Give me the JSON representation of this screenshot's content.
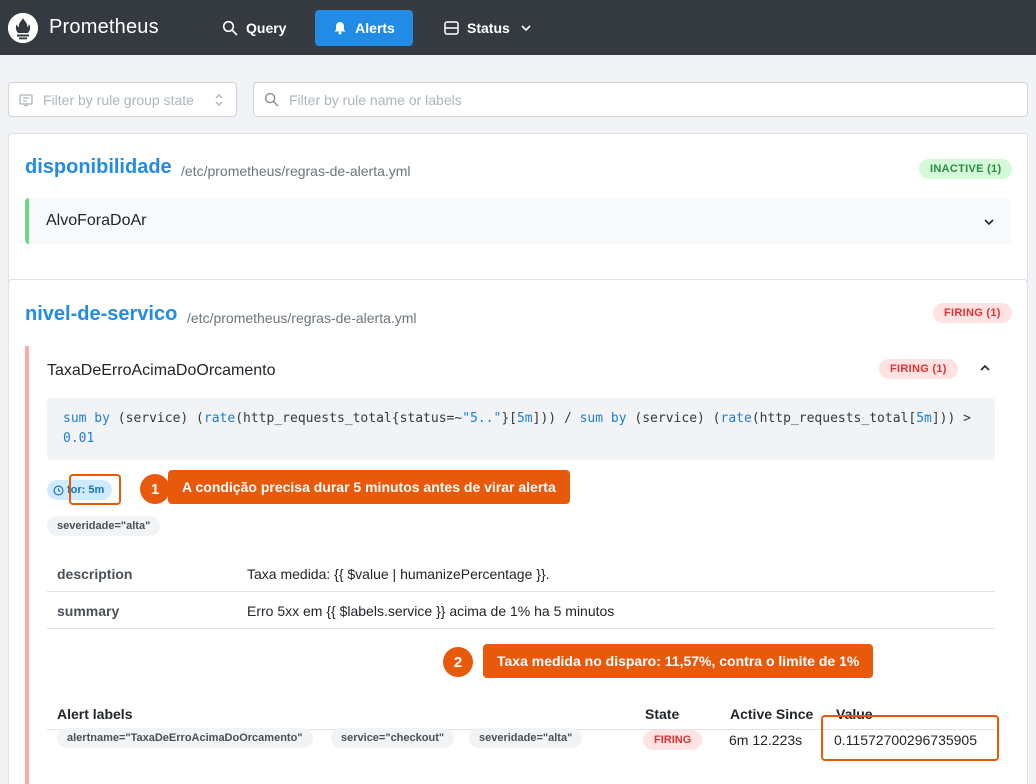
{
  "app": {
    "name": "Prometheus",
    "nav": {
      "query": "Query",
      "alerts": "Alerts",
      "status": "Status"
    }
  },
  "filters": {
    "group_state_placeholder": "Filter by rule group state",
    "search_placeholder": "Filter by rule name or labels"
  },
  "groups": [
    {
      "name": "disponibilidade",
      "file": "/etc/prometheus/regras-de-alerta.yml",
      "badge": "INACTIVE (1)",
      "rules": [
        {
          "name": "AlvoForaDoAr"
        }
      ]
    },
    {
      "name": "nivel-de-servico",
      "file": "/etc/prometheus/regras-de-alerta.yml",
      "badge": "FIRING (1)",
      "rule": {
        "name": "TaxaDeErroAcimaDoOrcamento",
        "badge": "FIRING (1)",
        "expr_line1": "sum by (service) (rate(http_requests_total{status=~\"5..\"}[5m])) / sum by (service) (rate(http_requests_total[5m])) >",
        "expr_line2": "0.01",
        "for": "for: 5m",
        "labels": [
          "severidade=\"alta\""
        ],
        "annotations": [
          {
            "key": "description",
            "value": "Taxa medida: {{ $value | humanizePercentage }}."
          },
          {
            "key": "summary",
            "value": "Erro 5xx em {{ $labels.service }} acima de 1% ha 5 minutos"
          }
        ],
        "alerts_table": {
          "headers": {
            "labels": "Alert labels",
            "state": "State",
            "active_since": "Active Since",
            "value": "Value"
          },
          "rows": [
            {
              "labels": [
                "alertname=\"TaxaDeErroAcimaDoOrcamento\"",
                "service=\"checkout\"",
                "severidade=\"alta\""
              ],
              "state": "FIRING",
              "active_since": "6m 12.223s",
              "value": "0.11572700296735905"
            }
          ]
        }
      }
    }
  ],
  "callouts": [
    {
      "number": "1",
      "text": "A condição precisa durar 5 minutos antes de virar alerta"
    },
    {
      "number": "2",
      "text": "Taxa medida no disparo: 11,57%, contra o limite de 1%"
    }
  ],
  "colors": {
    "navbar": "#343a40",
    "accent": "#228be6",
    "callout": "#e8590c",
    "firing": "#e03131",
    "inactive": "#2b8a3e"
  }
}
